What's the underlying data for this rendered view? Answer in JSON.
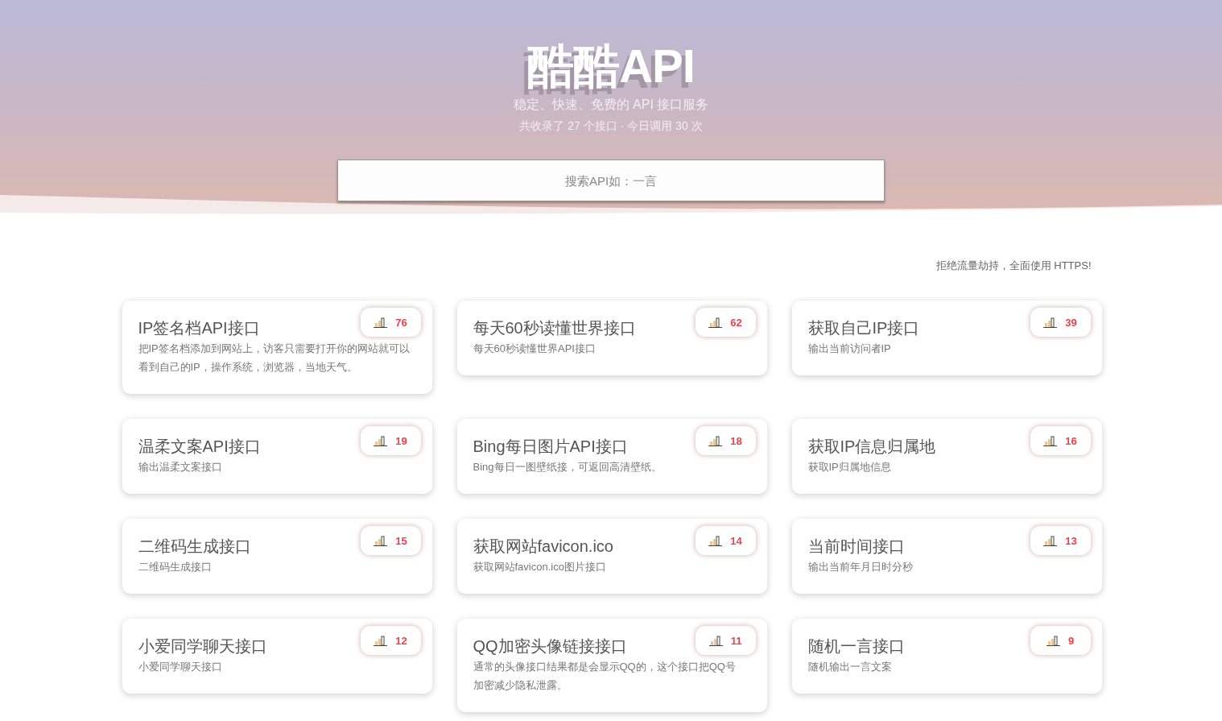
{
  "header": {
    "title": "酷酷API",
    "subtitle": "稳定、快速、免费的 API 接口服务",
    "stats": "共收录了 27 个接口 · 今日调用 30 次",
    "search": {
      "placeholder": "搜索API如：一言"
    }
  },
  "notice": "拒绝流量劫持，全面使用 HTTPS!",
  "cards": [
    {
      "title": "IP签名档API接口",
      "description": "把IP签名档添加到网站上，访客只需要打开你的网站就可以看到自己的IP，操作系统，浏览器，当地天气。",
      "count": "76"
    },
    {
      "title": "每天60秒读懂世界接口",
      "description": "每天60秒读懂世界API接口",
      "count": "62"
    },
    {
      "title": "获取自己IP接口",
      "description": "输出当前访问者IP",
      "count": "39"
    },
    {
      "title": "温柔文案API接口",
      "description": "输出温柔文案接口",
      "count": "19"
    },
    {
      "title": "Bing每日图片API接口",
      "description": "Bing每日一图壁纸接，可返回高清壁纸。",
      "count": "18"
    },
    {
      "title": "获取IP信息归属地",
      "description": "获取IP归属地信息",
      "count": "16"
    },
    {
      "title": "二维码生成接口",
      "description": "二维码生成接口",
      "count": "15"
    },
    {
      "title": "获取网站favicon.ico",
      "description": "获取网站favicon.ico图片接口",
      "count": "14"
    },
    {
      "title": "当前时间接口",
      "description": "输出当前年月日时分秒",
      "count": "13"
    },
    {
      "title": "小爱同学聊天接口",
      "description": "小爱同学聊天接口",
      "count": "12"
    },
    {
      "title": "QQ加密头像链接接口",
      "description": "通常的头像接口结果都是会显示QQ的，这个接口把QQ号加密减少隐私泄露。",
      "count": "11"
    },
    {
      "title": "随机一言接口",
      "description": "随机输出一言文案",
      "count": "9"
    }
  ]
}
